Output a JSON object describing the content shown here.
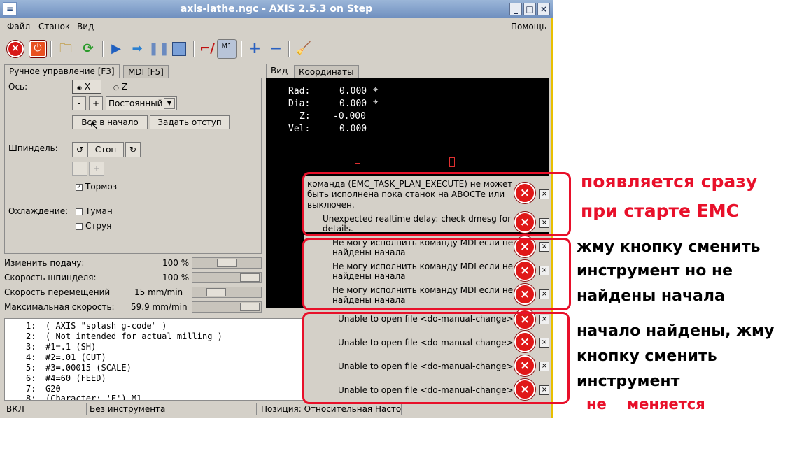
{
  "window": {
    "title": "axis-lathe.ngc - AXIS 2.5.3 on Step",
    "controls": [
      "_",
      "□",
      "×"
    ]
  },
  "menu": {
    "file": "Файл",
    "machine": "Станок",
    "view": "Вид",
    "help": "Помощь"
  },
  "toolbar": {
    "icons": [
      "estop-icon",
      "power-icon",
      "open-file-icon",
      "reload-icon",
      "run-icon",
      "step-icon",
      "pause-icon",
      "stop-icon",
      "block-delete-icon",
      "optional-stop-icon",
      "zoom-in-icon",
      "zoom-out-icon",
      "clear-plot-icon"
    ],
    "m1_label": "M1"
  },
  "left_tabs": {
    "manual": "Ручное управление [F3]",
    "mdi": "MDI [F5]"
  },
  "manual": {
    "axis_label": "Ось:",
    "axis_x": "X",
    "axis_z": "Z",
    "minus": "-",
    "plus": "+",
    "jog_mode": "Постоянный",
    "home_all": "Все в начало",
    "touch_off": "Задать отступ",
    "spindle_label": "Шпиндель:",
    "spindle_stop": "Стоп",
    "brake": "Тормоз",
    "coolant_label": "Охлаждение:",
    "mist": "Туман",
    "flood": "Струя"
  },
  "sliders": [
    {
      "label": "Изменить подачу:",
      "value": "100 %",
      "level": 0.5
    },
    {
      "label": "Скорость шпинделя:",
      "value": "100 %",
      "level": 0.78
    },
    {
      "label": "Скорость перемещений",
      "value": "15 mm/min",
      "level": 0.2
    },
    {
      "label": "Максимальная скорость:",
      "value": "59.9 mm/min",
      "level": 0.78
    }
  ],
  "right_tabs": {
    "view": "Вид",
    "coords": "Координаты"
  },
  "dro": [
    {
      "name": "Rad:",
      "value": "0.000"
    },
    {
      "name": "Dia:",
      "value": "0.000"
    },
    {
      "name": "Z:",
      "value": "-0.000"
    },
    {
      "name": "Vel:",
      "value": "0.000"
    }
  ],
  "code_lines": [
    {
      "n": "1:",
      "text": "( AXIS \"splash g-code\" )"
    },
    {
      "n": "2:",
      "text": "( Not intended for actual milling )"
    },
    {
      "n": "3:",
      "text": "#1=.1 (SH)"
    },
    {
      "n": "4:",
      "text": "#2=.01 (CUT)"
    },
    {
      "n": "5:",
      "text": "#3=.00015 (SCALE)"
    },
    {
      "n": "6:",
      "text": "#4=60 (FEED)"
    },
    {
      "n": "7:",
      "text": "G20"
    },
    {
      "n": "8:",
      "text": "(Character: 'E') M1"
    }
  ],
  "statusbar": {
    "state": "ВКЛ",
    "tool": "Без инструмента",
    "position": "Позиция: Относительная Насто"
  },
  "errors": {
    "e1a": "команда (EMC_TASK_PLAN_EXECUTE) не может",
    "e1b": "быть исполнена пока станок на АВОСТе или",
    "e1c": "выключен.",
    "e2a": "Unexpected realtime delay: check dmesg for",
    "e2b": "details.",
    "mdi_a": "Не могу исполнить команду MDI если не",
    "mdi_b": "найдены начала",
    "file": "Unable to open file <do-manual-change>"
  },
  "annotations": {
    "n1a": "появляется сразу",
    "n1b": "при старте ЕМС",
    "n2a": "жму кнопку сменить",
    "n2b": "инструмент но не",
    "n2c": "найдены начала",
    "n3a": "начало найдены, жму",
    "n3b": "кнопку сменить",
    "n3c": "инструмент",
    "n3d": "не    меняется"
  },
  "colors": {
    "annotation_red": "#e8102a",
    "titlebar": "#7f9cc8",
    "error_red": "#e01818"
  }
}
